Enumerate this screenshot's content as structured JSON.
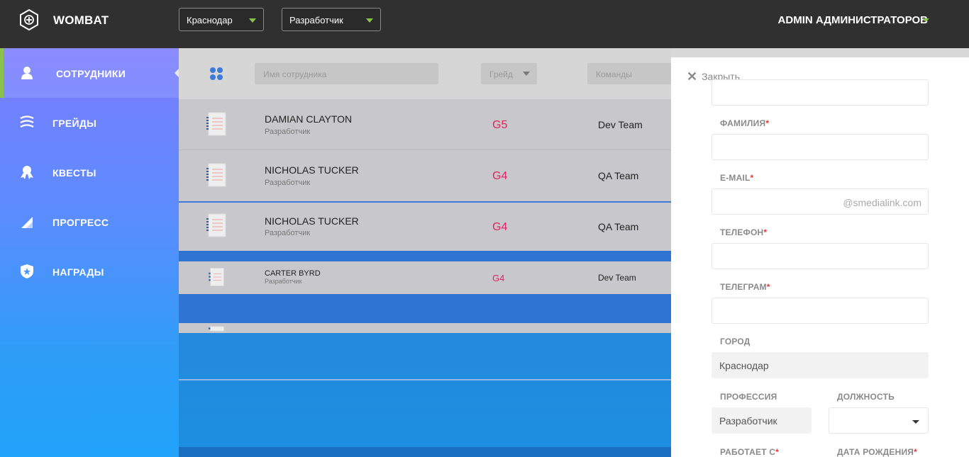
{
  "header": {
    "brand": "WOMBAT",
    "city_select": "Краснодар",
    "role_select": "Разработчик",
    "user": "ADMIN АДМИНИСТРАТОРОВ",
    "accent": "#8bc34a"
  },
  "sidebar": {
    "items": [
      {
        "label": "СОТРУДНИКИ",
        "icon": "user-icon",
        "active": true
      },
      {
        "label": "ГРЕЙДЫ",
        "icon": "layers-icon"
      },
      {
        "label": "КВЕСТЫ",
        "icon": "medal-icon"
      },
      {
        "label": "ПРОГРЕСС",
        "icon": "signal-icon"
      },
      {
        "label": "НАГРАДЫ",
        "icon": "shield-star-icon"
      }
    ]
  },
  "filters": {
    "name_placeholder": "Имя сотрудника",
    "grade_placeholder": "Грейд",
    "teams_placeholder": "Команды"
  },
  "employees": [
    {
      "name": "DAMIAN CLAYTON",
      "role": "Разработчик",
      "grade": "G5",
      "team": "Dev Team"
    },
    {
      "name": "NICHOLAS TUCKER",
      "role": "Разработчик",
      "grade": "G4",
      "team": "QA Team"
    },
    {
      "name": "NICHOLAS TUCKER",
      "role": "Разработчик",
      "grade": "G4",
      "team": "QA Team"
    },
    {
      "name": "CARTER BYRD",
      "role": "Разработчик",
      "grade": "G4",
      "team": "Dev Team"
    }
  ],
  "panel": {
    "close_label": "Закрыть",
    "fields": {
      "surname_label": "ФАМИЛИЯ",
      "email_label": "E-MAIL",
      "email_suffix": "@smedialink.com",
      "phone_label": "ТЕЛЕФОН",
      "telegram_label": "ТЕЛЕГРАМ",
      "city_label": "ГОРОД",
      "city_value": "Краснодар",
      "profession_label": "ПРОФЕССИЯ",
      "profession_value": "Разработчик",
      "position_label": "ДОЛЖНОСТЬ",
      "works_since_label": "РАБОТАЕТ С",
      "birth_date_label": "ДАТА РОЖДЕНИЯ",
      "required_mark": "*"
    }
  }
}
